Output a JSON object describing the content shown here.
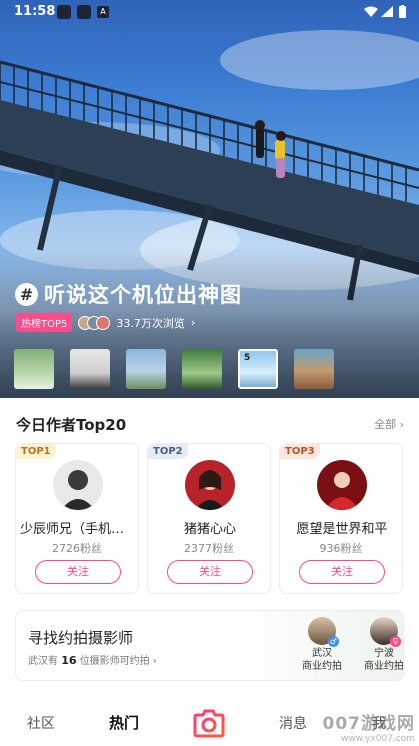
{
  "status_bar": {
    "time": "11:58",
    "notif_badge": "A"
  },
  "hero": {
    "topic_icon": "#",
    "title": "听说这个机位出神图",
    "hot_badge": "热榜TOP5",
    "views": "33.7万次浏览",
    "views_chevron": "›",
    "thumbnails": [
      {
        "index": 1,
        "label": ""
      },
      {
        "index": 2,
        "label": ""
      },
      {
        "index": 3,
        "label": ""
      },
      {
        "index": 4,
        "label": ""
      },
      {
        "index": 5,
        "label": "5",
        "active": true
      },
      {
        "index": 6,
        "label": ""
      }
    ]
  },
  "top_authors": {
    "title": "今日作者Top20",
    "more": "全部 ›",
    "authors": [
      {
        "rank": "TOP1",
        "name": "少辰师兄（手机摄…",
        "fans": "2726粉丝",
        "follow": "关注"
      },
      {
        "rank": "TOP2",
        "name": "猪猪心心",
        "fans": "2377粉丝",
        "follow": "关注"
      },
      {
        "rank": "TOP3",
        "name": "愿望是世界和平",
        "fans": "936粉丝",
        "follow": "关注"
      }
    ]
  },
  "finder": {
    "title": "寻找约拍摄影师",
    "sub_prefix": "武汉有",
    "count": "16",
    "sub_suffix": "位摄影师可约拍 ›",
    "photographers": [
      {
        "city": "武汉",
        "tag": "商业约拍",
        "gender": "♂"
      },
      {
        "city": "宁波",
        "tag": "商业约拍",
        "gender": "♀"
      }
    ]
  },
  "bottom_nav": {
    "community": "社区",
    "hot": "热门",
    "camera_icon": "camera-icon",
    "messages": "消息",
    "me": "我"
  },
  "watermark": {
    "brand": "007游戏网",
    "url": "www.yx007.com"
  },
  "colors": {
    "accent": "#ff4a8b",
    "text": "#222222",
    "muted": "#888888"
  }
}
